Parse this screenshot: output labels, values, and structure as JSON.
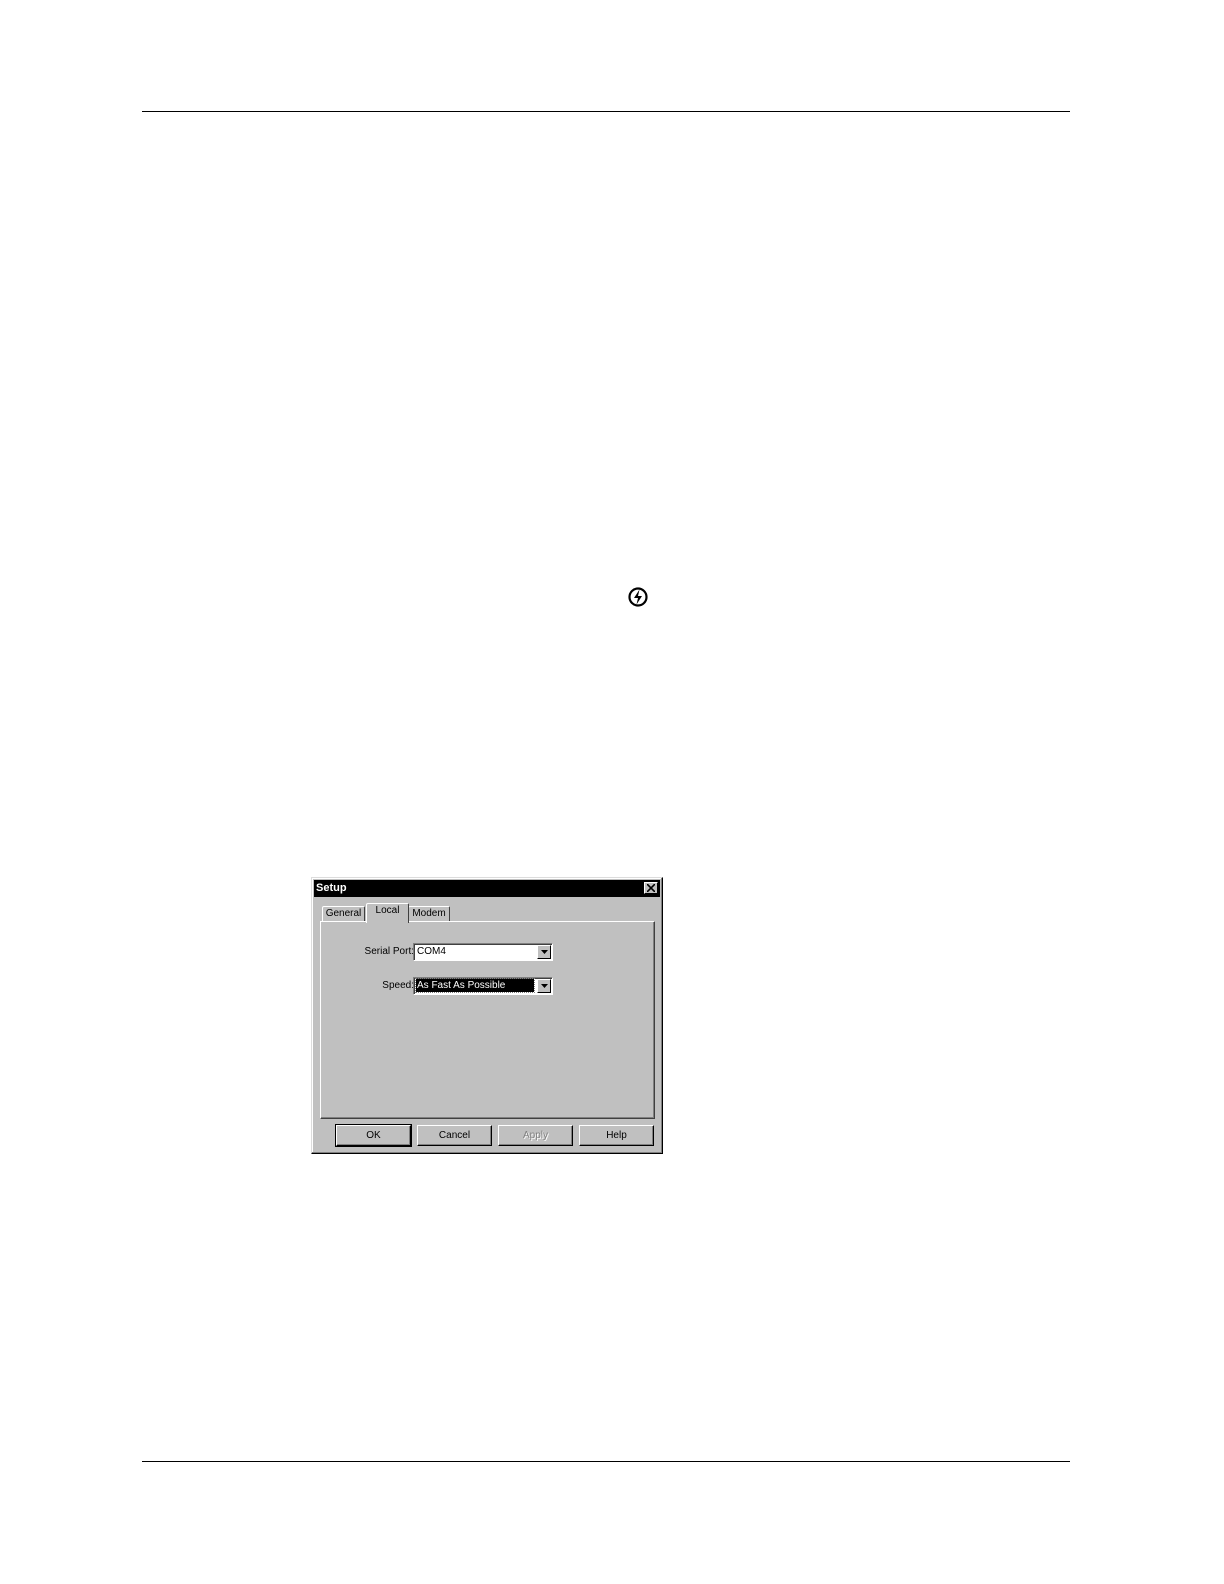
{
  "dialog": {
    "title": "Setup",
    "tabs": [
      {
        "label": "General"
      },
      {
        "label": "Local"
      },
      {
        "label": "Modem"
      }
    ],
    "active_tab": "Local",
    "fields": {
      "serial_port": {
        "label": "Serial Port:",
        "value": "COM4"
      },
      "speed": {
        "label": "Speed:",
        "value": "As Fast As Possible"
      }
    },
    "buttons": {
      "ok": "OK",
      "cancel": "Cancel",
      "apply": "Apply",
      "help": "Help"
    }
  },
  "icons": {
    "hotsync": "hotsync-icon",
    "close": "close-icon",
    "dropdown": "chevron-down-icon"
  }
}
